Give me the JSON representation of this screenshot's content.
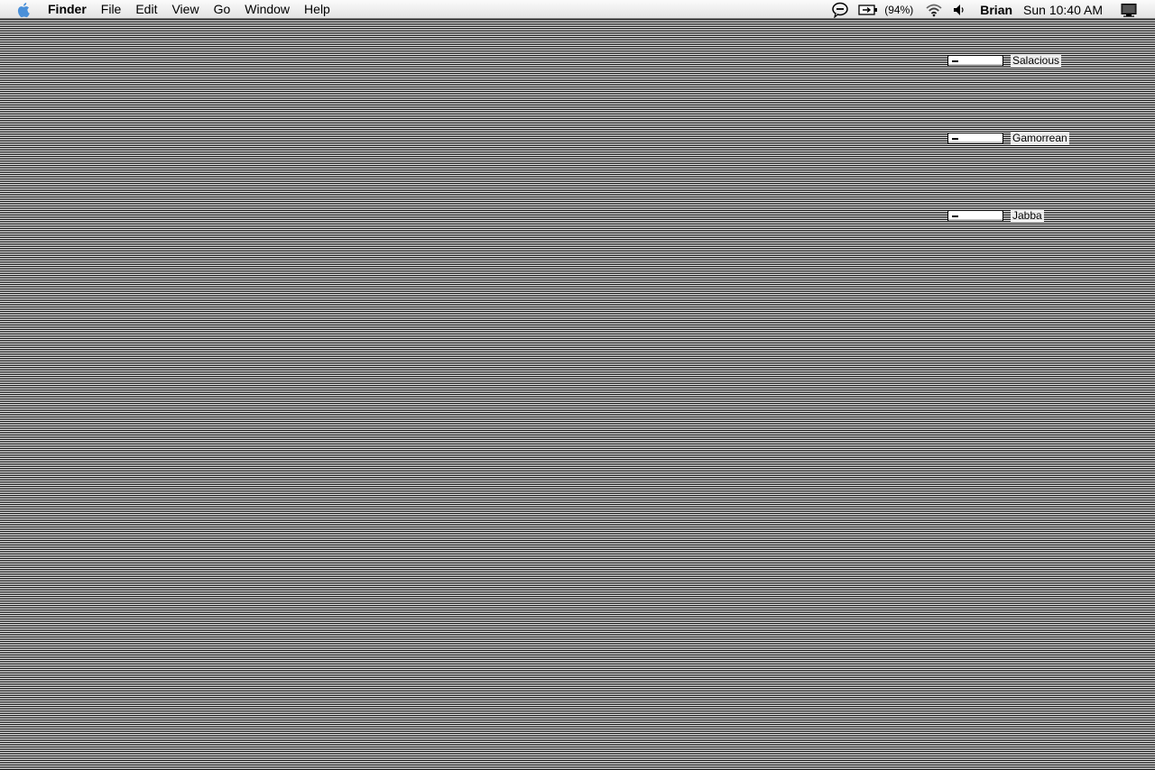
{
  "menubar": {
    "apple_icon": "apple-icon",
    "app_name": "Finder",
    "menus": [
      "File",
      "Edit",
      "View",
      "Go",
      "Window",
      "Help"
    ],
    "status": {
      "chat_icon": "ichat-status-icon",
      "battery_icon": "battery-icon",
      "battery_percent": "(94%)",
      "wifi_icon": "wifi-icon",
      "volume_icon": "volume-icon",
      "user": "Brian",
      "clock": "Sun 10:40 AM",
      "display_icon": "display-icon"
    }
  },
  "desktop": {
    "drives": [
      {
        "label": "Salacious",
        "icon": "drive-icon"
      },
      {
        "label": "Gamorrean",
        "icon": "drive-icon"
      },
      {
        "label": "Jabba",
        "icon": "drive-icon"
      }
    ]
  }
}
